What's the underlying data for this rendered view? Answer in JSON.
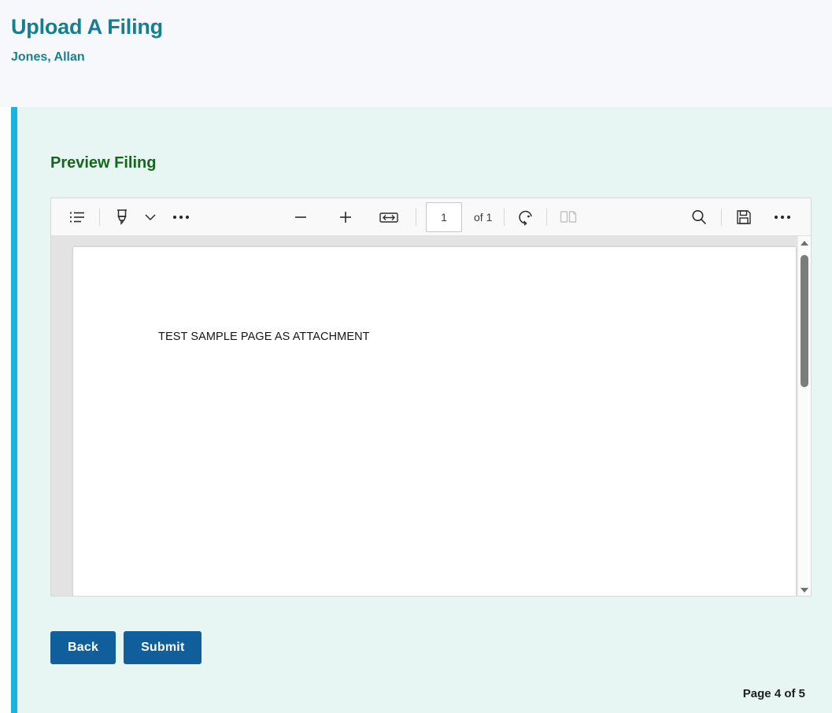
{
  "header": {
    "title": "Upload A Filing",
    "subtitle": "Jones, Allan",
    "title_color": "#147f90"
  },
  "panel": {
    "section_heading": "Preview Filing",
    "heading_color": "#16661d",
    "accent_color": "#15b5dd",
    "background_color": "#e7f5f3"
  },
  "pdf_viewer": {
    "toolbar": {
      "left_tools": [
        {
          "name": "toc-icon",
          "label": "Table of contents"
        },
        {
          "name": "highlighter-icon",
          "label": "Highlight"
        },
        {
          "name": "chevron-down-icon",
          "label": "Highlight options"
        },
        {
          "name": "more-tools-icon",
          "label": "More tools"
        }
      ],
      "zoom_out_label": "Zoom out",
      "zoom_in_label": "Zoom in",
      "fit_width_label": "Fit to width",
      "page_number_value": "1",
      "page_number_placeholder": "1",
      "page_total_text": "of 1",
      "rotate_label": "Rotate",
      "page_view_label": "Page view",
      "search_label": "Find",
      "save_label": "Save",
      "more_label": "More options"
    },
    "document": {
      "page_text": "TEST SAMPLE PAGE AS ATTACHMENT"
    },
    "scrollbar": {
      "up_label": "Scroll up",
      "down_label": "Scroll down"
    }
  },
  "actions": {
    "back_label": "Back",
    "submit_label": "Submit",
    "button_color": "#115e9c"
  },
  "footer": {
    "page_counter": "Page 4 of 5"
  }
}
